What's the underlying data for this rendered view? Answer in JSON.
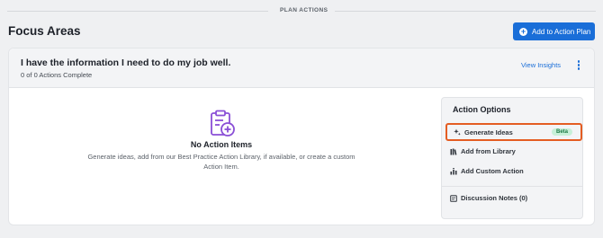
{
  "header": {
    "section_label": "PLAN ACTIONS",
    "page_title": "Focus Areas",
    "add_button_label": "Add to Action Plan"
  },
  "focus_area": {
    "title": "I have the information I need to do my job well.",
    "progress": "0 of 0 Actions Complete",
    "insights_link": "View Insights"
  },
  "empty_state": {
    "title": "No Action Items",
    "description": "Generate ideas, add from our Best Practice Action Library, if available, or create a custom Action Item."
  },
  "action_options": {
    "title": "Action Options",
    "generate_label": "Generate Ideas",
    "beta_badge": "Beta",
    "library_label": "Add from Library",
    "custom_label": "Add Custom Action",
    "notes_label": "Discussion Notes (0)"
  },
  "colors": {
    "accent": "#1a6ed8",
    "highlight": "#e45d22",
    "icon_purple": "#8a4fd6"
  }
}
